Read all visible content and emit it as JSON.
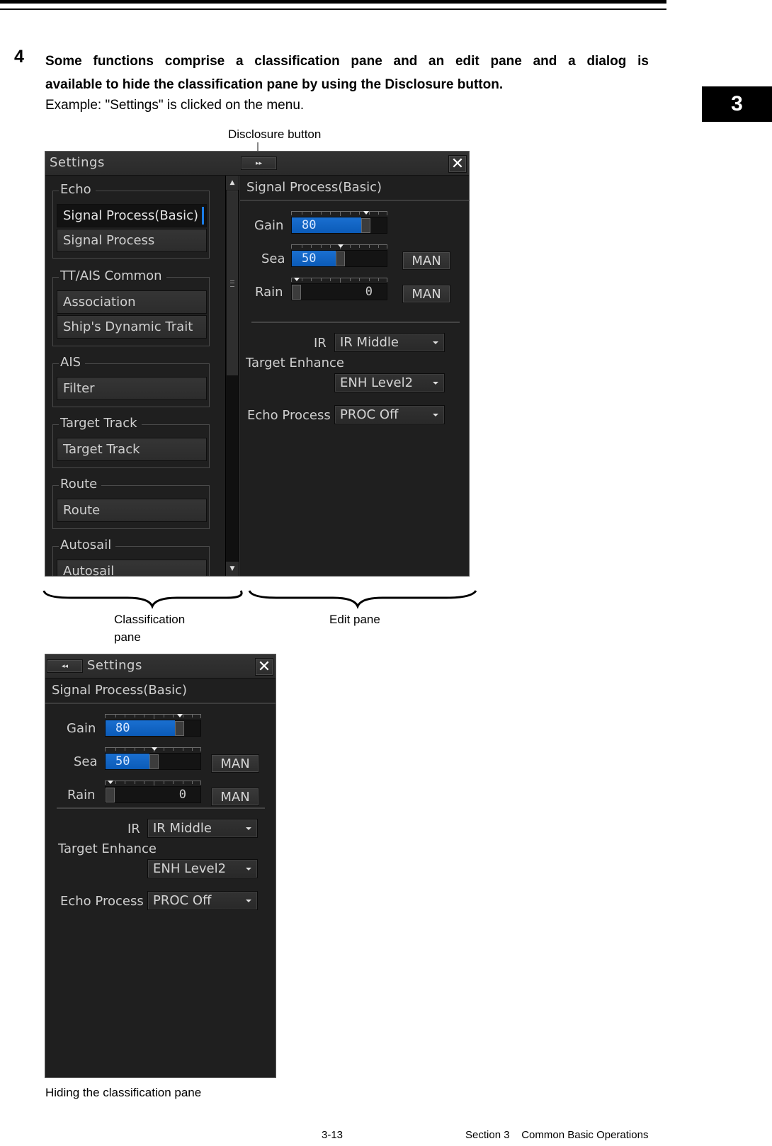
{
  "page": {
    "step_number": "4",
    "step_text_line1": "Some functions comprise a classification pane and an edit pane and a dialog is",
    "step_text_line2": "available to hide the classification pane by using the Disclosure button.",
    "example_text": "Example: \"Settings\" is clicked on the menu.",
    "chapter_tab": "3",
    "callout_disclosure": "Disclosure button",
    "label_classification_line1": "Classification",
    "label_classification_line2": "pane",
    "label_edit_pane": "Edit pane",
    "caption_hidden": "Hiding the classification pane",
    "footer_page": "3-13",
    "footer_section": "Section 3    Common Basic Operations"
  },
  "dialog_full": {
    "title": "Settings",
    "disclosure_icon": "double-chevron-right",
    "close_icon": "close-x",
    "classification": {
      "groups": [
        {
          "label": "Echo",
          "items": [
            {
              "label": "Signal Process(Basic)",
              "selected": true
            },
            {
              "label": "Signal Process",
              "selected": false
            }
          ]
        },
        {
          "label": "TT/AIS Common",
          "items": [
            {
              "label": "Association",
              "selected": false
            },
            {
              "label": "Ship's Dynamic Trait",
              "selected": false
            }
          ]
        },
        {
          "label": "AIS",
          "items": [
            {
              "label": "Filter",
              "selected": false
            }
          ]
        },
        {
          "label": "Target Track",
          "items": [
            {
              "label": "Target Track",
              "selected": false
            }
          ]
        },
        {
          "label": "Route",
          "items": [
            {
              "label": "Route",
              "selected": false
            }
          ]
        },
        {
          "label": "Autosail",
          "items": [
            {
              "label": "Autosail",
              "selected": false
            }
          ]
        }
      ]
    }
  },
  "dialog_hidden": {
    "title": "Settings",
    "disclosure_icon": "double-chevron-left",
    "close_icon": "close-x"
  },
  "edit_pane": {
    "title": "Signal Process(Basic)",
    "gain": {
      "label": "Gain",
      "value": "80",
      "percent": 80
    },
    "sea": {
      "label": "Sea",
      "value": "50",
      "percent": 50,
      "mode": "MAN"
    },
    "rain": {
      "label": "Rain",
      "value": "0",
      "percent": 0,
      "mode": "MAN"
    },
    "ir": {
      "label": "IR",
      "value": "IR Middle"
    },
    "target_enhance": {
      "label": "Target Enhance",
      "value": "ENH Level2"
    },
    "echo_process": {
      "label": "Echo Process",
      "value": "PROC Off"
    }
  },
  "colors": {
    "accent_blue": "#0b5bb8",
    "selection_bar": "#1a7ce6",
    "dialog_bg": "#1f1f1f"
  }
}
